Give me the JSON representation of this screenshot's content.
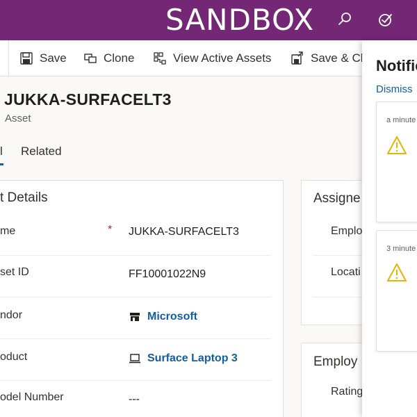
{
  "banner": {
    "environment_label": "SANDBOX"
  },
  "icons": {
    "search": "search-icon",
    "task": "task-check-icon",
    "save": "save-icon",
    "clone": "clone-icon",
    "view": "hierarchy-icon",
    "save_close": "save-close-icon",
    "vendor": "store-icon",
    "product": "laptop-icon",
    "warning": "warning-icon"
  },
  "colors": {
    "banner": "#742774",
    "link": "#115ea3",
    "required": "#a4262c",
    "warning": "#e3b505"
  },
  "commandbar": {
    "save": "Save",
    "clone": "Clone",
    "view_active_assets": "View Active Assets",
    "save_close": "Save & Cl"
  },
  "record": {
    "title": "JUKKA-SURFACELT3",
    "type": "Asset"
  },
  "tabs": {
    "general": "l",
    "related": "Related"
  },
  "details": {
    "section_title": "t Details",
    "required_marker": "*",
    "fields": [
      {
        "label": "me",
        "value": "JUKKA-SURFACELT3"
      },
      {
        "label": "set ID",
        "value": "FF10001022N9"
      },
      {
        "label": "ndor",
        "value": "Microsoft"
      },
      {
        "label": "oduct",
        "value": "Surface Laptop 3"
      },
      {
        "label": "odel Number",
        "value": "---"
      }
    ]
  },
  "assigned": {
    "section_title": "Assigne",
    "fields": [
      "Emplo",
      "Locati"
    ]
  },
  "employee": {
    "section_title": "Employ",
    "fields": [
      "Rating"
    ]
  },
  "notifications": {
    "title": "Notifications",
    "dismiss": "Dismiss",
    "items": [
      {
        "time": "a minute"
      },
      {
        "time": "3 minute"
      }
    ]
  }
}
